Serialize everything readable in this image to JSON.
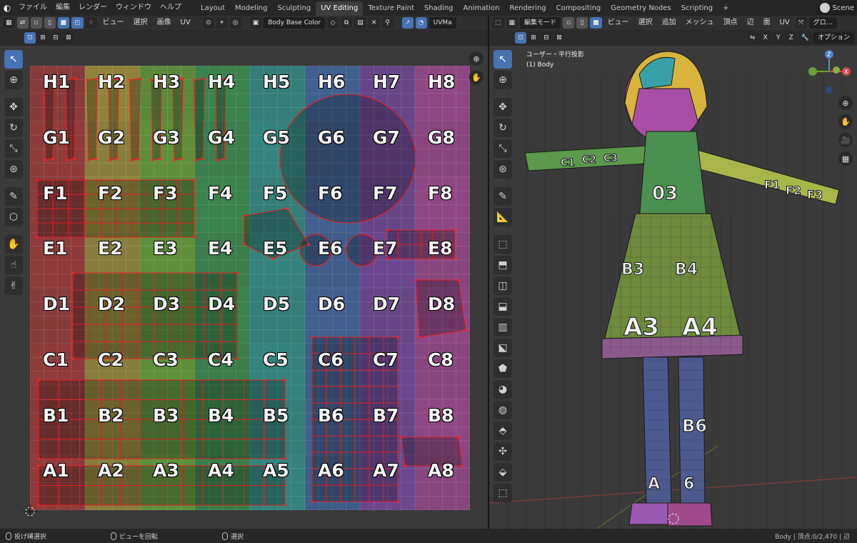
{
  "topbar": {
    "menus": [
      "ファイル",
      "編集",
      "レンダー",
      "ウィンドウ",
      "ヘルプ"
    ],
    "workspaces": [
      "Layout",
      "Modeling",
      "Sculpting",
      "UV Editing",
      "Texture Paint",
      "Shading",
      "Animation",
      "Rendering",
      "Compositing",
      "Geometry Nodes",
      "Scripting"
    ],
    "active_workspace": "UV Editing",
    "add_tab": "+",
    "scene_label": "Scene"
  },
  "uv_editor": {
    "header_menus": [
      "ビュー",
      "選択",
      "画像",
      "UV"
    ],
    "image_name": "Body Base Color",
    "uvmap_label": "UVMa",
    "grid_labels": {
      "rows": [
        "H",
        "G",
        "F",
        "E",
        "D",
        "C",
        "B",
        "A"
      ],
      "cols": [
        "1",
        "2",
        "3",
        "4",
        "5",
        "6",
        "7",
        "8"
      ]
    },
    "column_colors": [
      "#c83c3c",
      "#c8b43c",
      "#78c83c",
      "#3cb45a",
      "#32b4aa",
      "#4678c8",
      "#8c50c8",
      "#c850b4"
    ]
  },
  "viewport": {
    "header_menus": [
      "ビュー",
      "選択",
      "追加",
      "メッシュ",
      "頂点",
      "辺",
      "面",
      "UV"
    ],
    "mode_label": "編集モード",
    "transform_label": "グロ…",
    "axes": [
      "X",
      "Y",
      "Z"
    ],
    "options_label": "オプション",
    "view_title": "ユーザー・平行投影",
    "object_label": "(1) Body",
    "model_labels": [
      "03",
      "B3",
      "B4",
      "A3",
      "A4",
      "B6",
      "A",
      "6",
      "F1",
      "F2",
      "F3",
      "C1",
      "C2",
      "C3"
    ]
  },
  "statusbar": {
    "left": "投げ縄選択",
    "middle": "ビューを回転",
    "right_action": "選択",
    "stats": "Body | 頂点:0/2,470 | 辺"
  }
}
